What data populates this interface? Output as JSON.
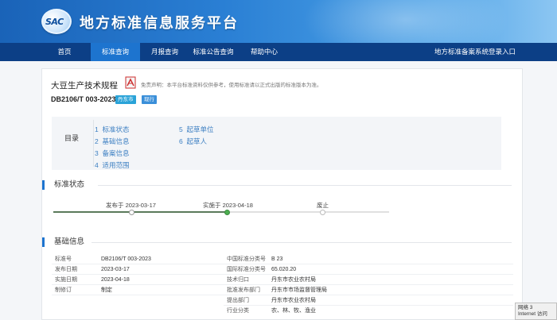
{
  "header": {
    "logo_text": "SAC",
    "site_title": "地方标准信息服务平台"
  },
  "nav": {
    "items": [
      {
        "label": "首页",
        "active": false
      },
      {
        "label": "标准查询",
        "active": true
      },
      {
        "label": "月报查询",
        "active": false
      },
      {
        "label": "标准公告查询",
        "active": false
      },
      {
        "label": "帮助中心",
        "active": false
      }
    ],
    "right_link": "地方标准备案系统登录入口"
  },
  "standard": {
    "title": "大豆生产技术规程",
    "disclaimer": "免责声明：本平台标准资料仅供参考，使用标准请以正式出版的标准版本为准。",
    "code": "DB2106/T 003-2023",
    "tags": {
      "region": "丹东市",
      "status": "现行"
    }
  },
  "toc": {
    "label": "目录",
    "items": [
      {
        "num": "1",
        "label": "标准状态"
      },
      {
        "num": "2",
        "label": "基础信息"
      },
      {
        "num": "3",
        "label": "备案信息"
      },
      {
        "num": "4",
        "label": "适用范围"
      },
      {
        "num": "5",
        "label": "起草单位"
      },
      {
        "num": "6",
        "label": "起草人"
      }
    ]
  },
  "status_section": {
    "title": "标准状态",
    "timeline": [
      {
        "label": "发布于 2023-03-17",
        "state": "done"
      },
      {
        "label": "实施于 2023-04-18",
        "state": "current"
      },
      {
        "label": "废止",
        "state": "pending"
      }
    ],
    "colors": {
      "done": "#5a7a5a",
      "pending": "#d9d9d9",
      "current_dot": "#4caf50"
    }
  },
  "basic_section": {
    "title": "基础信息",
    "left": [
      {
        "label": "标准号",
        "value": "DB2106/T 003-2023"
      },
      {
        "label": "发布日期",
        "value": "2023-03-17"
      },
      {
        "label": "实施日期",
        "value": "2023-04-18"
      },
      {
        "label": "制修订",
        "value": "制定"
      }
    ],
    "right": [
      {
        "label": "中国标准分类号",
        "value": "B 23"
      },
      {
        "label": "国际标准分类号",
        "value": "65.020.20"
      },
      {
        "label": "技术归口",
        "value": "丹东市农业农村局"
      },
      {
        "label": "批准发布部门",
        "value": "丹东市市场监督管理局"
      },
      {
        "label": "提出部门",
        "value": "丹东市农业农村局"
      },
      {
        "label": "行业分类",
        "value": "农、林、牧、渔业"
      }
    ]
  },
  "statusbar": {
    "line1": "网络 3",
    "line2": "Internet 访问"
  },
  "colors": {
    "nav_bg": "#0c3f86",
    "nav_active": "#1d74cf",
    "accent": "#1d74cf",
    "link": "#3c7fc2"
  }
}
